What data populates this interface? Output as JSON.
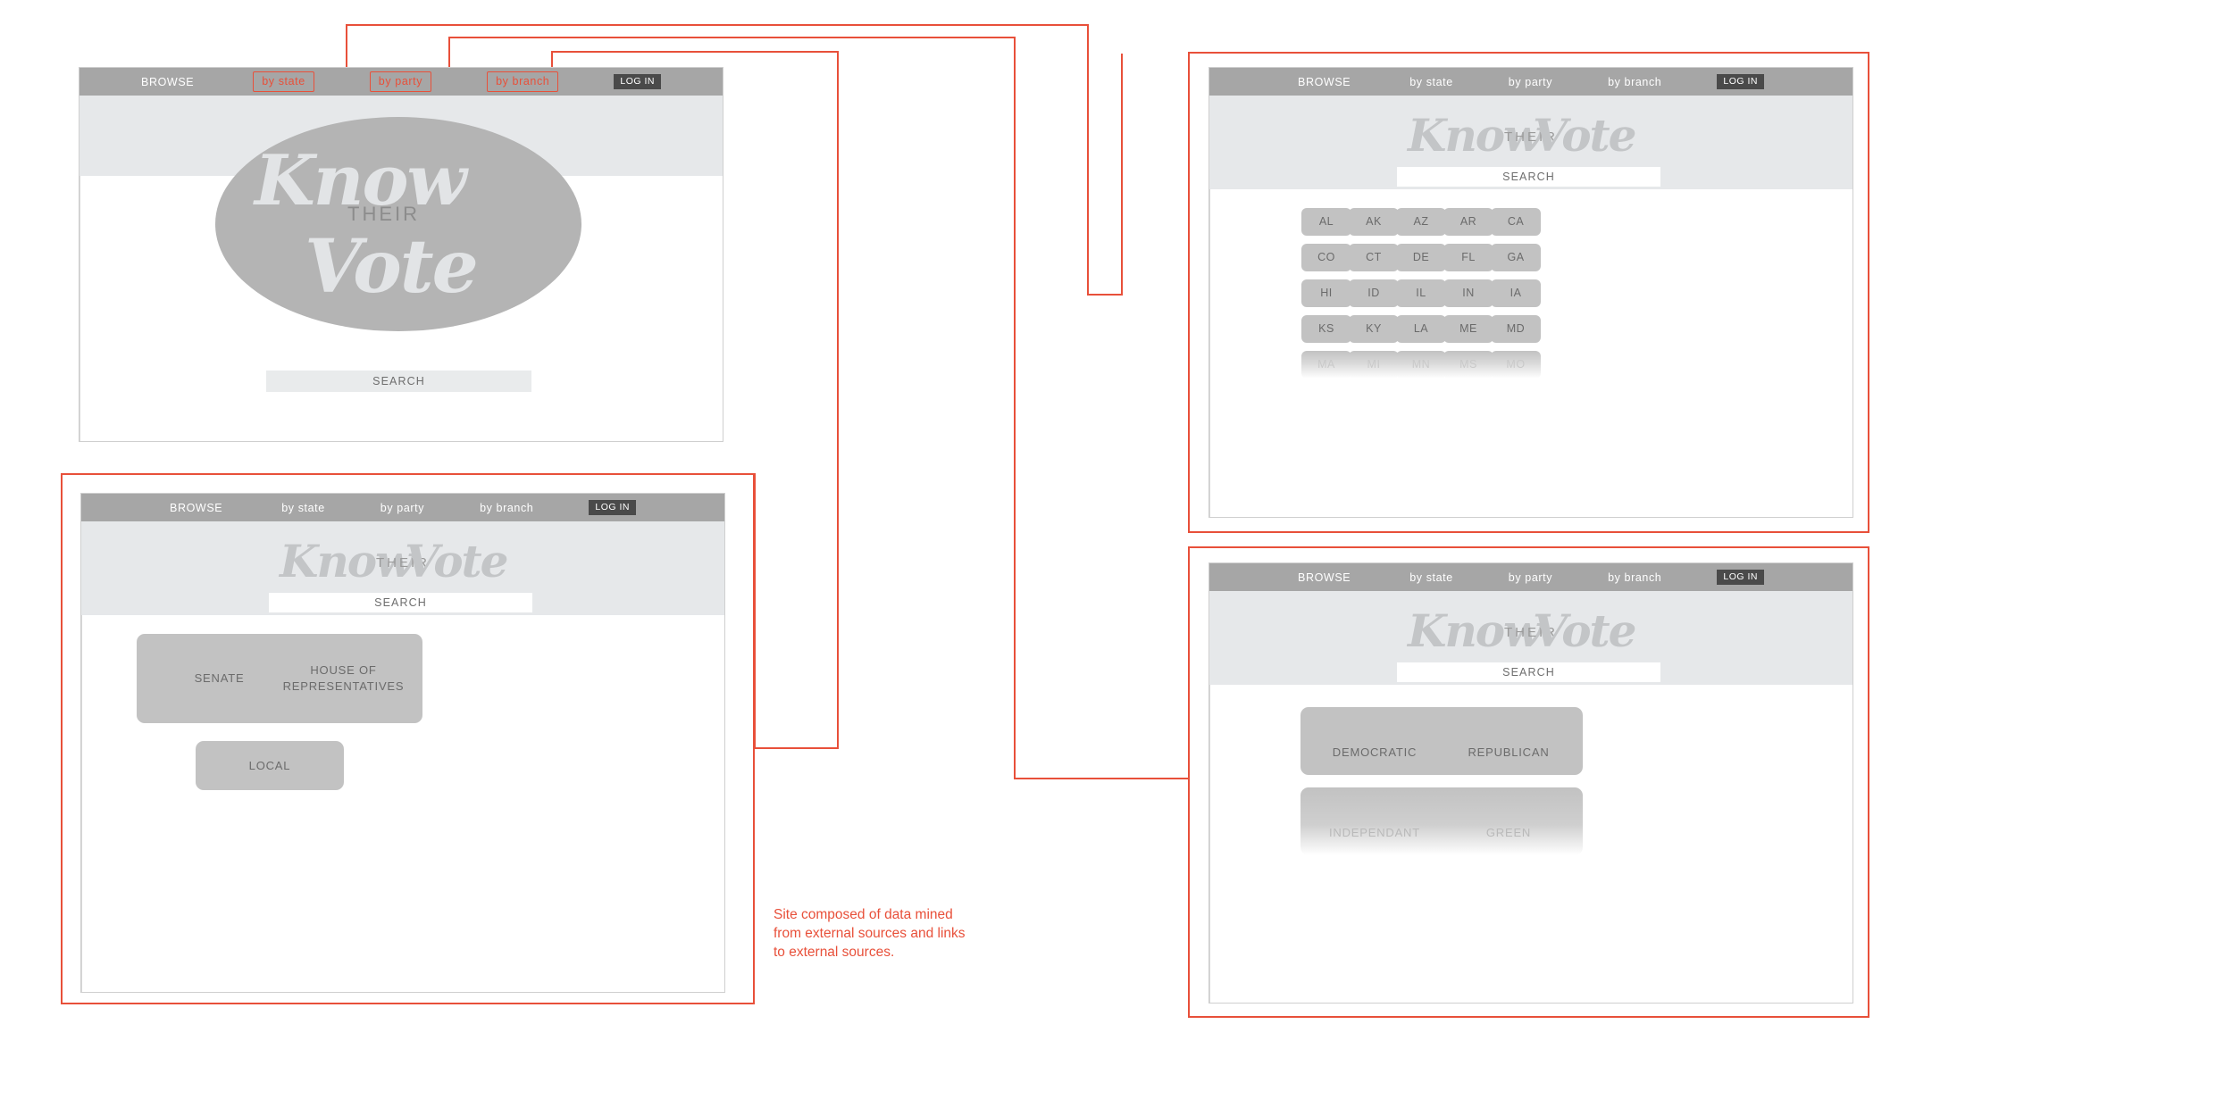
{
  "meta": {
    "accent_red": "#e8503a",
    "nav_bg": "#a6a6a6",
    "hero_bg": "#e6e8ea",
    "tile_gray": "#c2c2c2"
  },
  "nav": {
    "browse": "BROWSE",
    "by_state": "by state",
    "by_party": "by party",
    "by_branch": "by branch",
    "login": "LOG IN"
  },
  "logo": {
    "know": "Know",
    "their": "THEIR",
    "vote": "Vote"
  },
  "search": {
    "label": "SEARCH"
  },
  "screens": {
    "home": {
      "name": "home-landing"
    },
    "branch": {
      "name": "browse-by-branch",
      "tiles": [
        "SENATE",
        "HOUSE OF REPRESENTATIVES",
        "LOCAL"
      ]
    },
    "state": {
      "name": "browse-by-state",
      "rows": [
        [
          "AL",
          "AK",
          "AZ",
          "AR",
          "CA"
        ],
        [
          "CO",
          "CT",
          "DE",
          "FL",
          "GA"
        ],
        [
          "HI",
          "ID",
          "IL",
          "IN",
          "IA"
        ],
        [
          "KS",
          "KY",
          "LA",
          "ME",
          "MD"
        ],
        [
          "MA",
          "MI",
          "MN",
          "MS",
          "MO"
        ]
      ]
    },
    "party": {
      "name": "browse-by-party",
      "tiles": [
        "DEMOCRATIC",
        "REPUBLICAN",
        "INDEPENDANT",
        "GREEN"
      ]
    }
  },
  "annotation": {
    "note": "Site composed of data mined from external sources and links to external sources."
  }
}
